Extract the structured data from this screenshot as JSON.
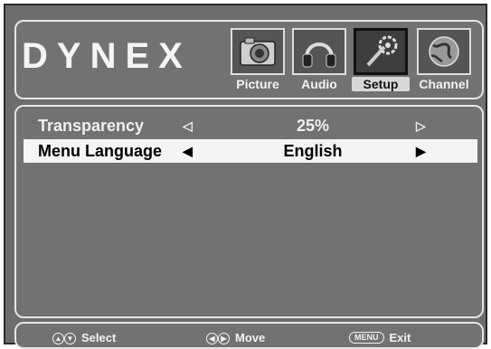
{
  "brand": {
    "logo_text": "DYNEX"
  },
  "tabs": [
    {
      "label": "Picture",
      "icon": "camera-icon",
      "active": false
    },
    {
      "label": "Audio",
      "icon": "headphones-icon",
      "active": false
    },
    {
      "label": "Setup",
      "icon": "gear-tool-icon",
      "active": true
    },
    {
      "label": "Channel",
      "icon": "globe-icon",
      "active": false
    }
  ],
  "settings": [
    {
      "label": "Transparency",
      "value": "25%",
      "selected": false
    },
    {
      "label": "Menu Language",
      "value": "English",
      "selected": true
    }
  ],
  "footer": {
    "select_label": "Select",
    "move_label": "Move",
    "menu_key": "MENU",
    "exit_label": "Exit"
  }
}
